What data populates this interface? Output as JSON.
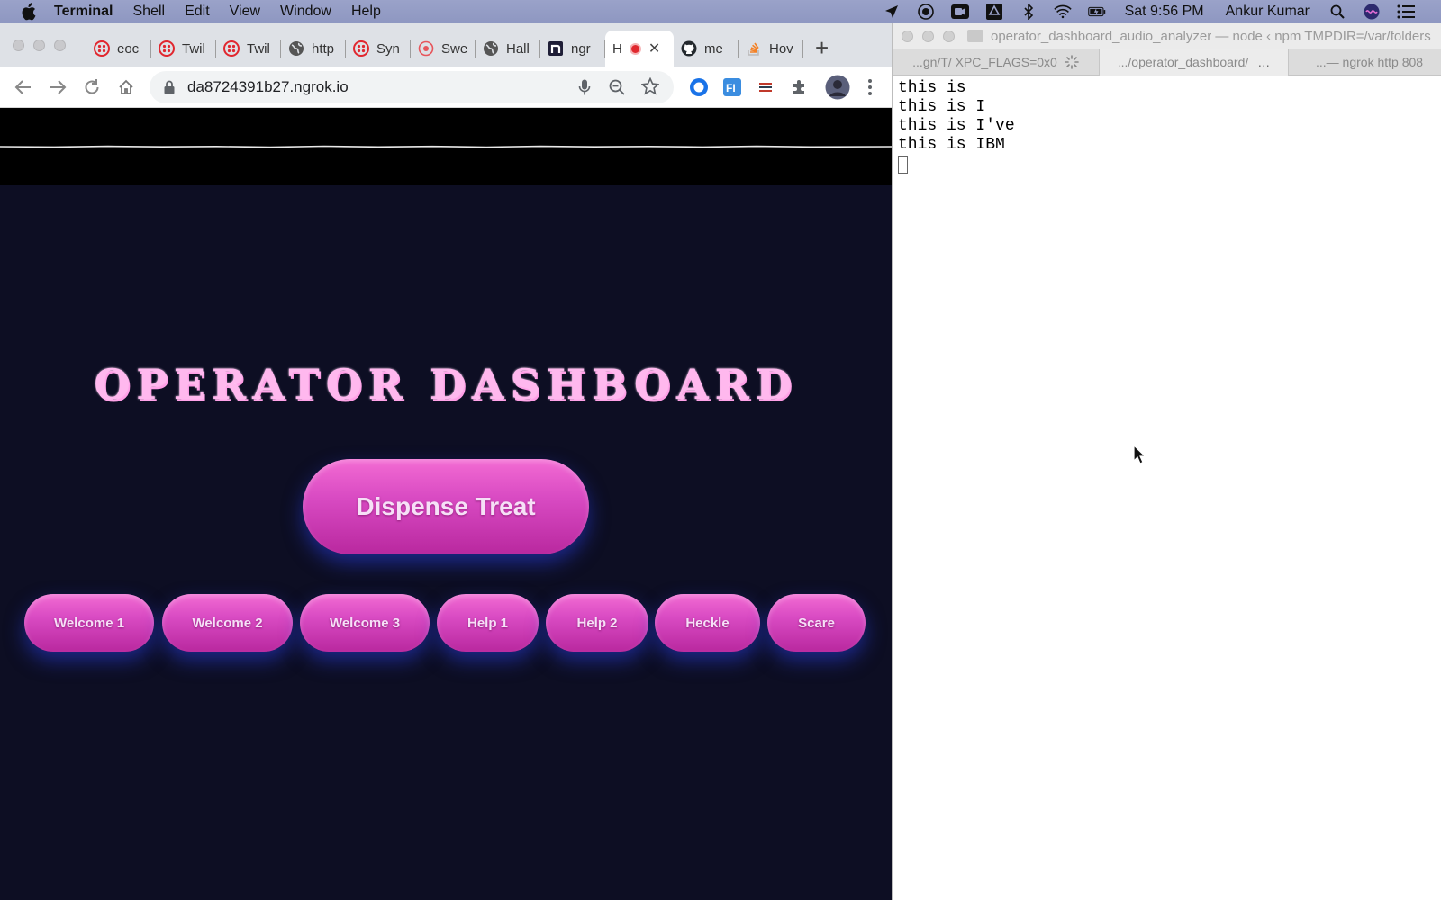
{
  "menubar": {
    "app_name": "Terminal",
    "items": [
      "Shell",
      "Edit",
      "View",
      "Window",
      "Help"
    ],
    "clock": "Sat 9:56 PM",
    "user": "Ankur Kumar"
  },
  "browser": {
    "tabs": [
      {
        "label": "eoc",
        "icon": "twilio-icon"
      },
      {
        "label": "Twil",
        "icon": "twilio-icon"
      },
      {
        "label": "Twil",
        "icon": "twilio-icon"
      },
      {
        "label": "http",
        "icon": "globe-icon"
      },
      {
        "label": "Syn",
        "icon": "twilio-icon"
      },
      {
        "label": "Swe",
        "icon": "twilio-icon"
      },
      {
        "label": "Hall",
        "icon": "globe-icon"
      },
      {
        "label": "ngr",
        "icon": "ngrok-icon"
      },
      {
        "label": "H",
        "icon": "recording-icon",
        "active": true
      },
      {
        "label": "me",
        "icon": "github-icon"
      },
      {
        "label": "Hov",
        "icon": "stackoverflow-icon"
      }
    ],
    "url": "da8724391b27.ngrok.io"
  },
  "page": {
    "title": "OPERATOR DASHBOARD",
    "dispense_label": "Dispense Treat",
    "buttons": [
      "Welcome 1",
      "Welcome 2",
      "Welcome 3",
      "Help 1",
      "Help 2",
      "Heckle",
      "Scare"
    ]
  },
  "terminal": {
    "title": "operator_dashboard_audio_analyzer — node ‹ npm TMPDIR=/var/folders",
    "tabs": [
      "...gn/T/ XPC_FLAGS=0x0",
      ".../operator_dashboard/",
      "...— ngrok http 808"
    ],
    "lines": [
      "this is",
      "this is I",
      "this is I've",
      "this is IBM"
    ]
  },
  "colors": {
    "page_bg": "#0d0e23",
    "button_pink": "#d94bc3",
    "title_pink": "#ffb8ee",
    "glow_blue": "#3c3cdc"
  }
}
